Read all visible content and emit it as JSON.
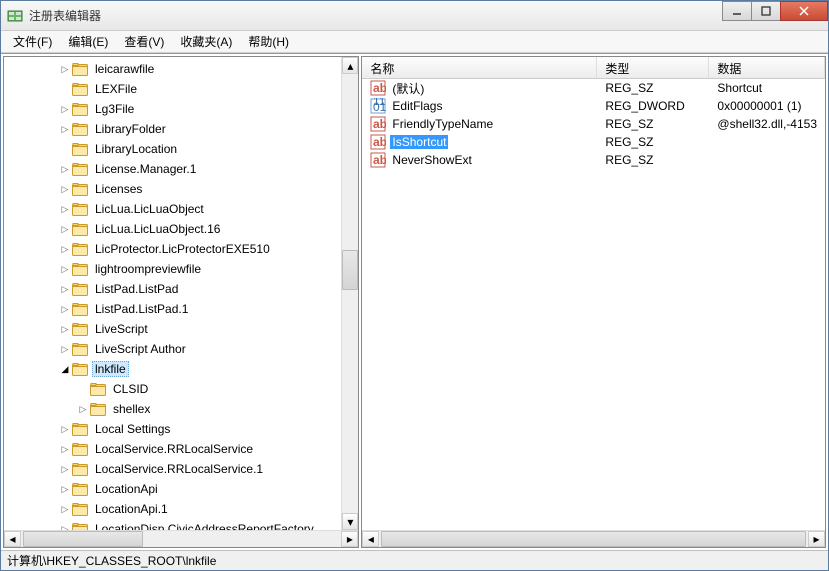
{
  "window": {
    "title": "注册表编辑器"
  },
  "menu": {
    "file": "文件(F)",
    "edit": "编辑(E)",
    "view": "查看(V)",
    "favorites": "收藏夹(A)",
    "help": "帮助(H)"
  },
  "tree": {
    "items": [
      {
        "indent": 3,
        "expander": "closed",
        "label": "leicarawfile"
      },
      {
        "indent": 3,
        "expander": "none",
        "label": "LEXFile"
      },
      {
        "indent": 3,
        "expander": "closed",
        "label": "Lg3File"
      },
      {
        "indent": 3,
        "expander": "closed",
        "label": "LibraryFolder"
      },
      {
        "indent": 3,
        "expander": "none",
        "label": "LibraryLocation"
      },
      {
        "indent": 3,
        "expander": "closed",
        "label": "License.Manager.1"
      },
      {
        "indent": 3,
        "expander": "closed",
        "label": "Licenses"
      },
      {
        "indent": 3,
        "expander": "closed",
        "label": "LicLua.LicLuaObject"
      },
      {
        "indent": 3,
        "expander": "closed",
        "label": "LicLua.LicLuaObject.16"
      },
      {
        "indent": 3,
        "expander": "closed",
        "label": "LicProtector.LicProtectorEXE510"
      },
      {
        "indent": 3,
        "expander": "closed",
        "label": "lightroompreviewfile"
      },
      {
        "indent": 3,
        "expander": "closed",
        "label": "ListPad.ListPad"
      },
      {
        "indent": 3,
        "expander": "closed",
        "label": "ListPad.ListPad.1"
      },
      {
        "indent": 3,
        "expander": "closed",
        "label": "LiveScript"
      },
      {
        "indent": 3,
        "expander": "closed",
        "label": "LiveScript Author"
      },
      {
        "indent": 3,
        "expander": "open",
        "label": "lnkfile",
        "selected": true
      },
      {
        "indent": 4,
        "expander": "none",
        "label": "CLSID"
      },
      {
        "indent": 4,
        "expander": "closed",
        "label": "shellex"
      },
      {
        "indent": 3,
        "expander": "closed",
        "label": "Local Settings"
      },
      {
        "indent": 3,
        "expander": "closed",
        "label": "LocalService.RRLocalService"
      },
      {
        "indent": 3,
        "expander": "closed",
        "label": "LocalService.RRLocalService.1"
      },
      {
        "indent": 3,
        "expander": "closed",
        "label": "LocationApi"
      },
      {
        "indent": 3,
        "expander": "closed",
        "label": "LocationApi.1"
      },
      {
        "indent": 3,
        "expander": "closed",
        "label": "LocationDisp.CivicAddressReportFactory"
      }
    ]
  },
  "list": {
    "columns": {
      "name": "名称",
      "type": "类型",
      "data": "数据"
    },
    "rows": [
      {
        "icon": "string",
        "name": "(默认)",
        "type": "REG_SZ",
        "data": "Shortcut"
      },
      {
        "icon": "binary",
        "name": "EditFlags",
        "type": "REG_DWORD",
        "data": "0x00000001 (1)"
      },
      {
        "icon": "string",
        "name": "FriendlyTypeName",
        "type": "REG_SZ",
        "data": "@shell32.dll,-4153"
      },
      {
        "icon": "string",
        "name": "IsShortcut",
        "type": "REG_SZ",
        "data": "",
        "selected": true
      },
      {
        "icon": "string",
        "name": "NeverShowExt",
        "type": "REG_SZ",
        "data": ""
      }
    ]
  },
  "status": {
    "path": "计算机\\HKEY_CLASSES_ROOT\\lnkfile"
  }
}
